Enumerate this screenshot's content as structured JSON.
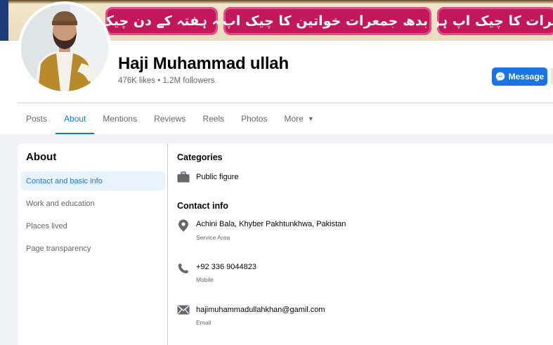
{
  "cover": {
    "banners": [
      "جمعہ ہفتہ کے دن چیک اپ",
      "منگل بدھ جمعرات خواتین کا چیک اپ ہوگا",
      "حضرات کا چیک اپ ہوگا"
    ]
  },
  "profile": {
    "name": "Haji Muhammad ullah",
    "stats": "476K likes • 1.2M followers"
  },
  "actions": {
    "message_label": "Message"
  },
  "tabs": [
    {
      "label": "Posts",
      "active": false
    },
    {
      "label": "About",
      "active": true
    },
    {
      "label": "Mentions",
      "active": false
    },
    {
      "label": "Reviews",
      "active": false
    },
    {
      "label": "Reels",
      "active": false
    },
    {
      "label": "Photos",
      "active": false
    },
    {
      "label": "More",
      "active": false
    }
  ],
  "sidebar": {
    "title": "About",
    "items": [
      {
        "label": "Contact and basic info",
        "active": true
      },
      {
        "label": "Work and education",
        "active": false
      },
      {
        "label": "Places lived",
        "active": false
      },
      {
        "label": "Page transparency",
        "active": false
      }
    ]
  },
  "categories": {
    "title": "Categories",
    "value": "Public figure",
    "icon": "briefcase-icon"
  },
  "contact": {
    "title": "Contact info",
    "rows": [
      {
        "icon": "location-pin-icon",
        "value": "Achini Bala, Khyber Pakhtunkhwa, Pakistan",
        "label": "Service Area"
      },
      {
        "icon": "phone-icon",
        "value": "+92 336 9044823",
        "label": "Mobile"
      },
      {
        "icon": "email-icon",
        "value": "hajimuhammadullahkhan@gamil.com",
        "label": "Email"
      }
    ]
  },
  "colors": {
    "accent": "#1b74e4",
    "banner": "#c2185b",
    "muted_text": "#65676b"
  }
}
